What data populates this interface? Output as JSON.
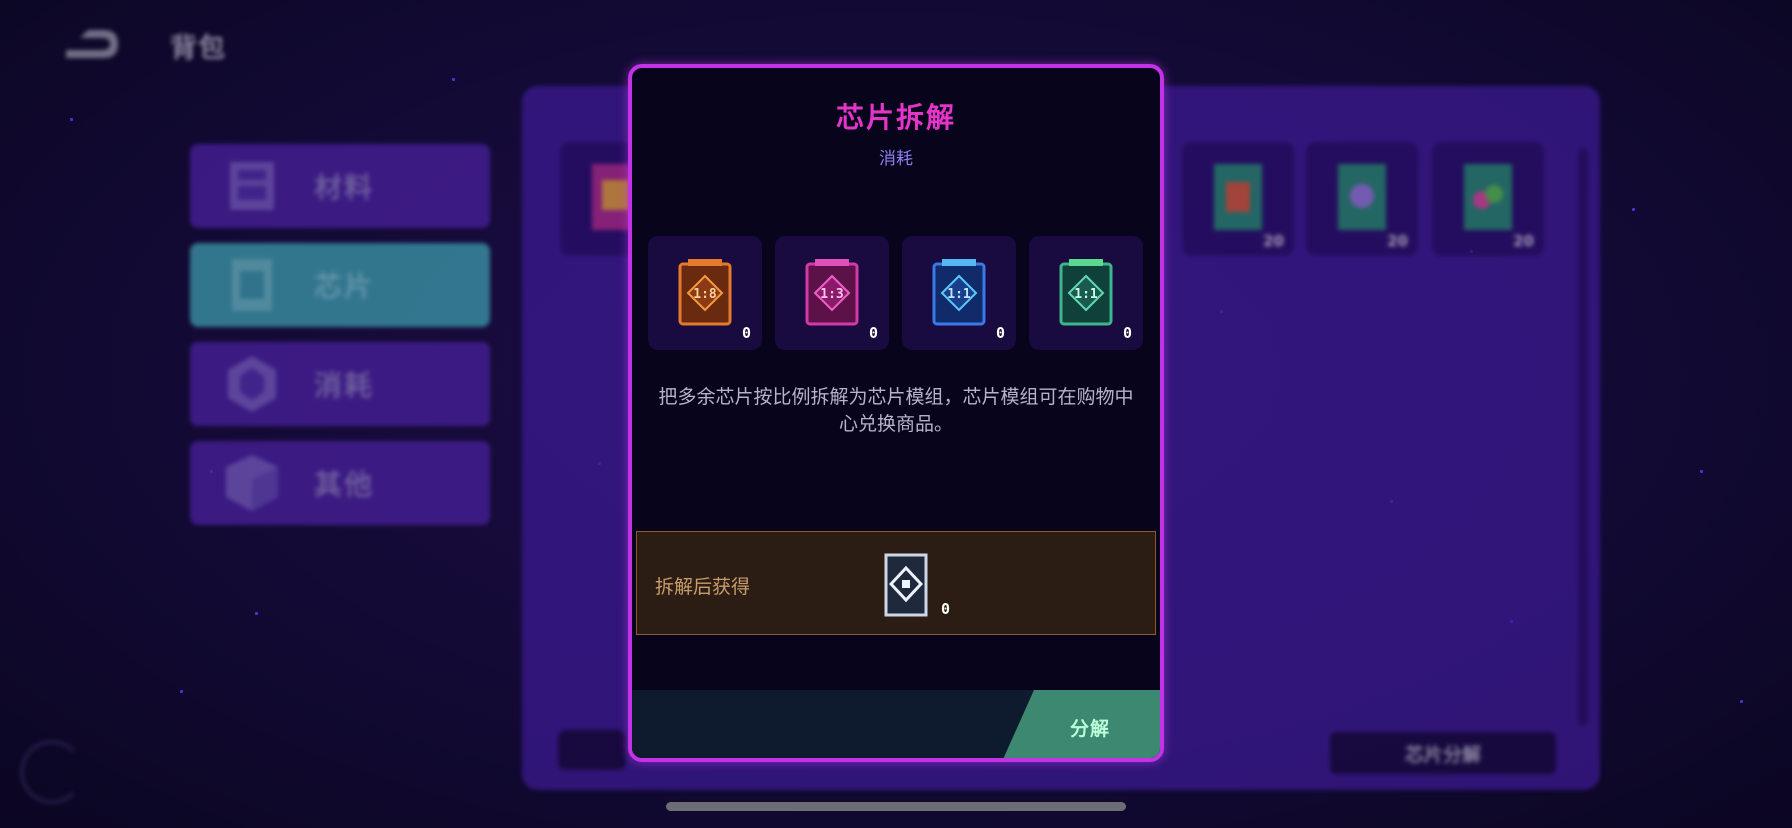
{
  "header": {
    "title": "背包",
    "back_icon": "back-arrow-icon"
  },
  "sidebar": {
    "items": [
      {
        "label": "材料",
        "icon": "materials-icon",
        "active": false
      },
      {
        "label": "芯片",
        "icon": "chip-icon",
        "active": true
      },
      {
        "label": "消耗",
        "icon": "consumable-icon",
        "active": false
      },
      {
        "label": "其他",
        "icon": "other-box-icon",
        "active": false
      }
    ]
  },
  "inventory": {
    "visible_counts": [
      "20",
      "20",
      "20"
    ],
    "decompose_button_label": "芯片分解"
  },
  "modal": {
    "title": "芯片拆解",
    "subtitle": "消耗",
    "chips": [
      {
        "ratio": "1:8",
        "count": "0",
        "color": "#e57a2c"
      },
      {
        "ratio": "1:3",
        "count": "0",
        "color": "#d43aa6"
      },
      {
        "ratio": "1:1",
        "count": "0",
        "color": "#3a7ae8"
      },
      {
        "ratio": "1:1",
        "count": "0",
        "color": "#3fb58e"
      }
    ],
    "description": "把多余芯片按比例拆解为芯片模组，芯片模组可在购物中心兑换商品。",
    "gain_label": "拆解后获得",
    "gain_count": "0",
    "confirm_label": "分解"
  },
  "colors": {
    "accent": "#c232e6",
    "title": "#e535c9",
    "confirm": "#3d8870"
  }
}
